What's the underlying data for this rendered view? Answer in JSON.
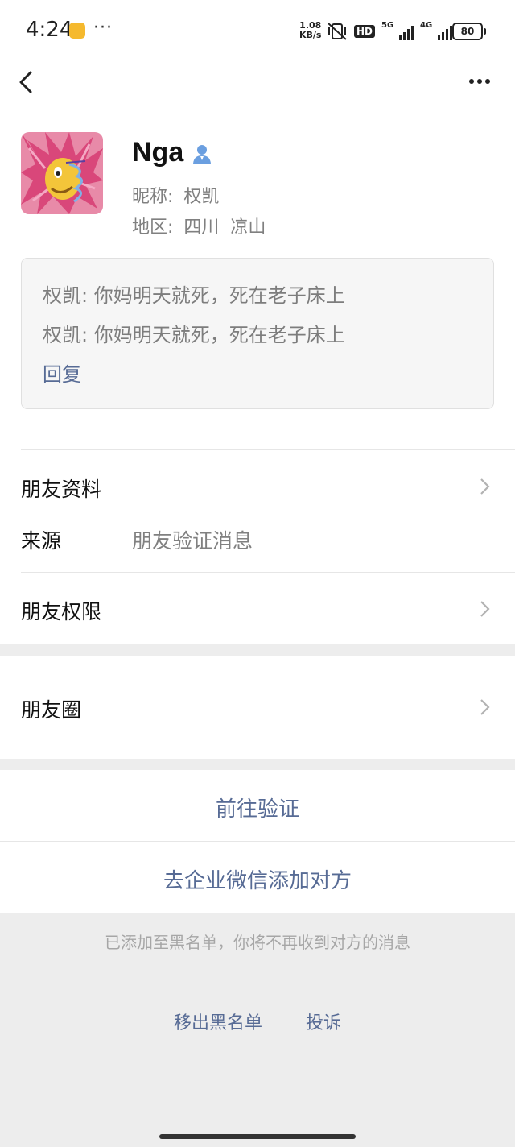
{
  "status_bar": {
    "time": "4:24",
    "more": "···",
    "net_speed_value": "1.08",
    "net_speed_unit": "KB/s",
    "hd": "HD",
    "signal_1": "5G",
    "signal_2": "4G",
    "battery": "80"
  },
  "profile": {
    "name": "Nga",
    "nickname_label": "昵称:",
    "nickname": "权凯",
    "region_label": "地区:",
    "region": "四川  凉山"
  },
  "messages": {
    "lines": [
      "权凯: 你妈明天就死，死在老子床上",
      "权凯: 你妈明天就死，死在老子床上"
    ],
    "reply_label": "回复"
  },
  "rows": {
    "friend_profile": "朋友资料",
    "source_label": "来源",
    "source_value": "朋友验证消息",
    "friend_permissions": "朋友权限",
    "moments": "朋友圈"
  },
  "actions": {
    "verify": "前往验证",
    "wecom_add": "去企业微信添加对方"
  },
  "blacklist": {
    "notice": "已添加至黑名单，你将不再收到对方的消息",
    "remove": "移出黑名单",
    "complain": "投诉"
  },
  "colors": {
    "link": "#576b95",
    "background": "#ededed"
  },
  "icons": [
    "back-arrow-icon",
    "more-icon",
    "user-icon",
    "chevron-right-icon"
  ]
}
